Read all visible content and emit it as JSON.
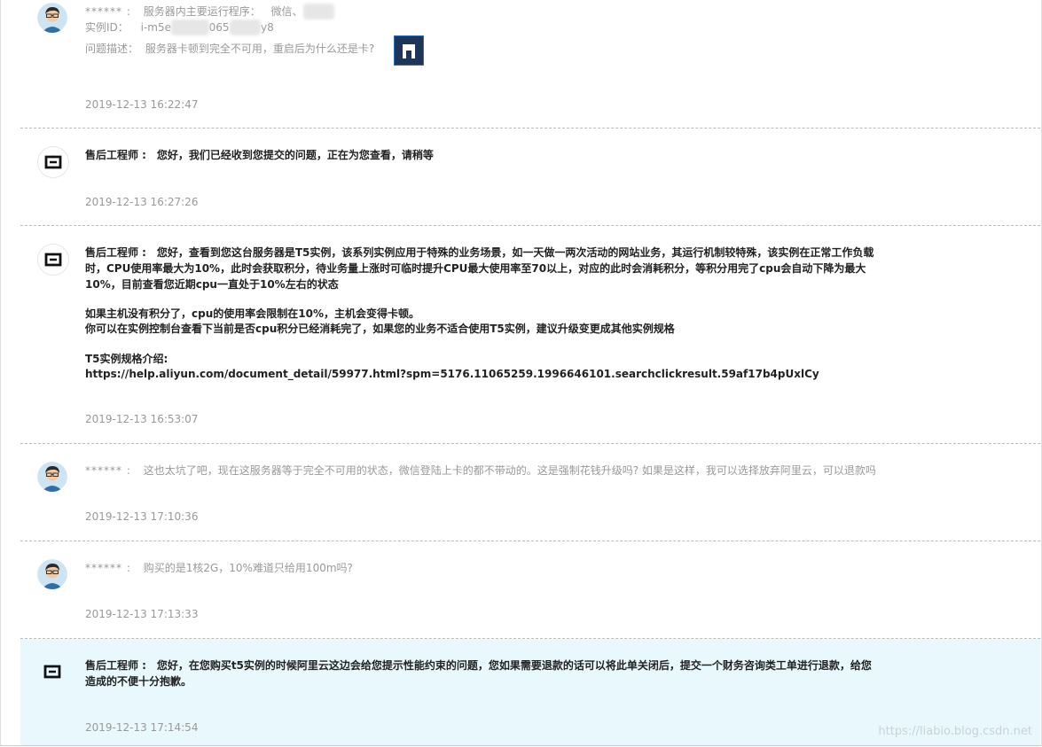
{
  "entries": [
    {
      "role": "user",
      "author": "****** :",
      "lines": [
        [
          "服务器内主要运行程序：",
          "微信、"
        ],
        [
          "实例ID：",
          "i-m5e",
          "065",
          "y8"
        ],
        [
          "问题描述：",
          "服务器卡顿到完全不可用，重启后为什么还是卡?"
        ]
      ],
      "timestamp": "2019-12-13 16:22:47"
    },
    {
      "role": "engineer",
      "author": "售后工程师 :",
      "lines": [
        "您好，我们已经收到您提交的问题，正在为您查看，请稍等"
      ],
      "timestamp": "2019-12-13 16:27:26"
    },
    {
      "role": "engineer",
      "author": "售后工程师 :",
      "lines": [
        "您好，查看到您这台服务器是T5实例，该系列实例应用于特殊的业务场景，如一天做一两次活动的网站业务，其运行机制较特殊，该实例在正常工作负载",
        "时，CPU使用率最大为10%，此时会获取积分，待业务量上涨时可临时提升CPU最大使用率至70以上，对应的此时会消耗积分，等积分用完了cpu会自动下降为最大",
        "10%，目前查看您近期cpu一直处于10%左右的状态",
        "如果主机没有积分了，cpu的使用率会限制在10%，主机会变得卡顿。",
        "你可以在实例控制台查看下当前是否cpu积分已经消耗完了，如果您的业务不适合使用T5实例，建议升级变更成其他实例规格",
        "T5实例规格介绍:",
        "https://help.aliyun.com/document_detail/59977.html?spm=5176.11065259.1996646101.searchclickresult.59af17b4pUxlCy"
      ],
      "timestamp": "2019-12-13 16:53:07"
    },
    {
      "role": "user",
      "author": "****** :",
      "lines": [
        "这也太坑了吧，现在这服务器等于完全不可用的状态，微信登陆上卡的都不带动的。这是强制花钱升级吗? 如果是这样，我可以选择放弃阿里云，可以退款吗"
      ],
      "timestamp": "2019-12-13 17:10:36"
    },
    {
      "role": "user",
      "author": "****** :",
      "lines": [
        "购买的是1核2G，10%难道只给用100m吗?"
      ],
      "timestamp": "2019-12-13 17:13:33"
    },
    {
      "role": "engineer",
      "author": "售后工程师 :",
      "lines": [
        "您好，在您购买t5实例的时候阿里云这边会给您提示性能约束的问题，您如果需要退款的话可以将此单关闭后，提交一个财务咨询类工单进行退款，给您",
        "造成的不便十分抱歉。"
      ],
      "timestamp": "2019-12-13 17:14:54"
    }
  ],
  "watermark": "https://liabio.blog.csdn.net",
  "icons": {
    "user_avatar": "user-avatar-icon",
    "engineer_avatar": "aliyun-logo-icon",
    "attachment": "image-thumbnail"
  },
  "colors": {
    "highlight_bg": "#e8f8fd",
    "meta_text": "#999999",
    "engineer_text": "#222222",
    "thumb_border": "#2a6fb8"
  }
}
